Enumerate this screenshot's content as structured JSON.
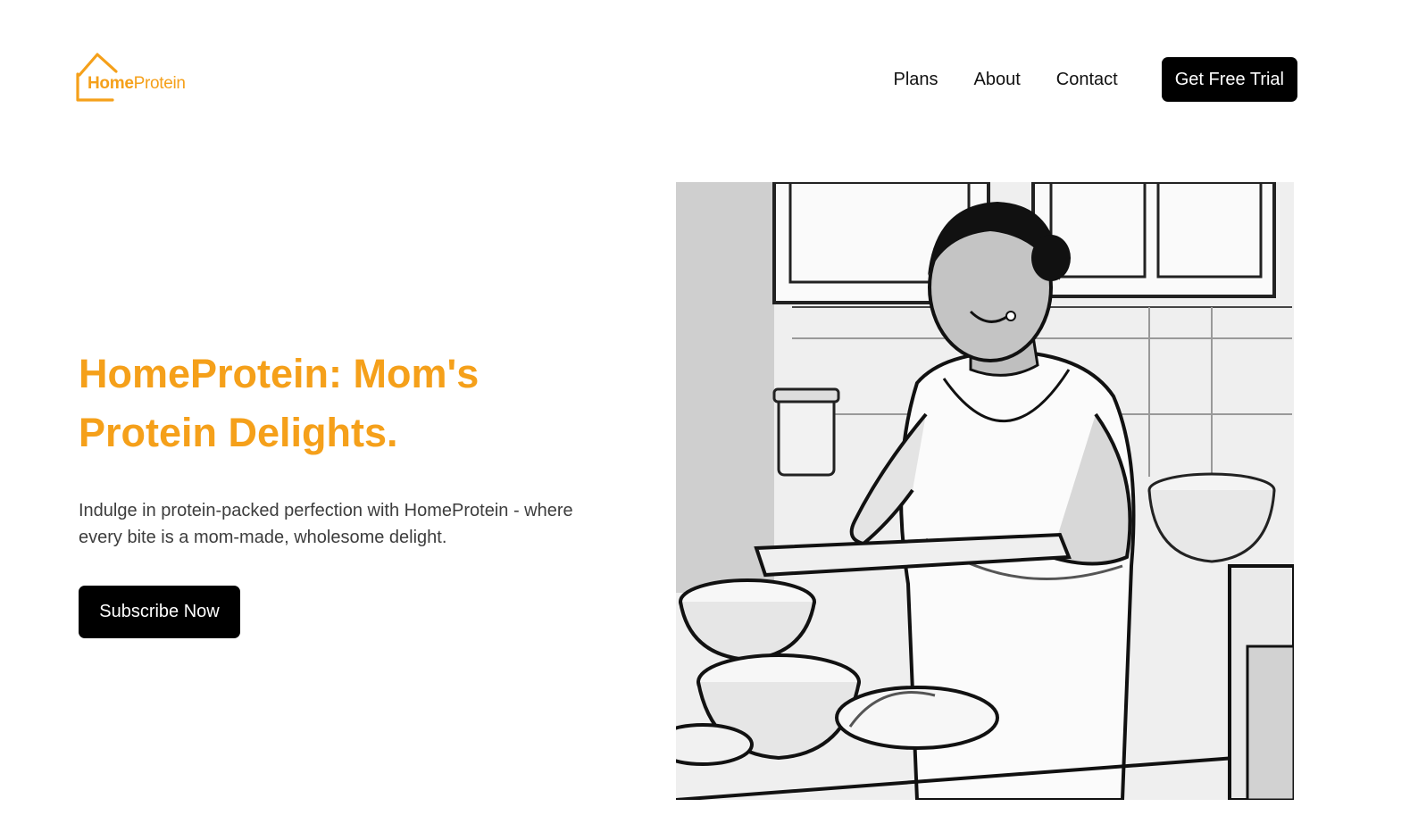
{
  "header": {
    "logo": {
      "home": "Home",
      "protein": "Protein"
    },
    "nav": [
      {
        "label": "Plans"
      },
      {
        "label": "About"
      },
      {
        "label": "Contact"
      }
    ],
    "cta_label": "Get Free Trial"
  },
  "hero": {
    "title": "HomeProtein: Mom's Protein Delights.",
    "description": "Indulge in protein-packed perfection with HomeProtein - where every bite is a mom-made, wholesome delight.",
    "button_label": "Subscribe Now",
    "image_icon": "cooking-woman-illustration"
  },
  "colors": {
    "accent": "#f5a01a",
    "button_bg": "#000000",
    "body_text": "#3d3d3d"
  }
}
